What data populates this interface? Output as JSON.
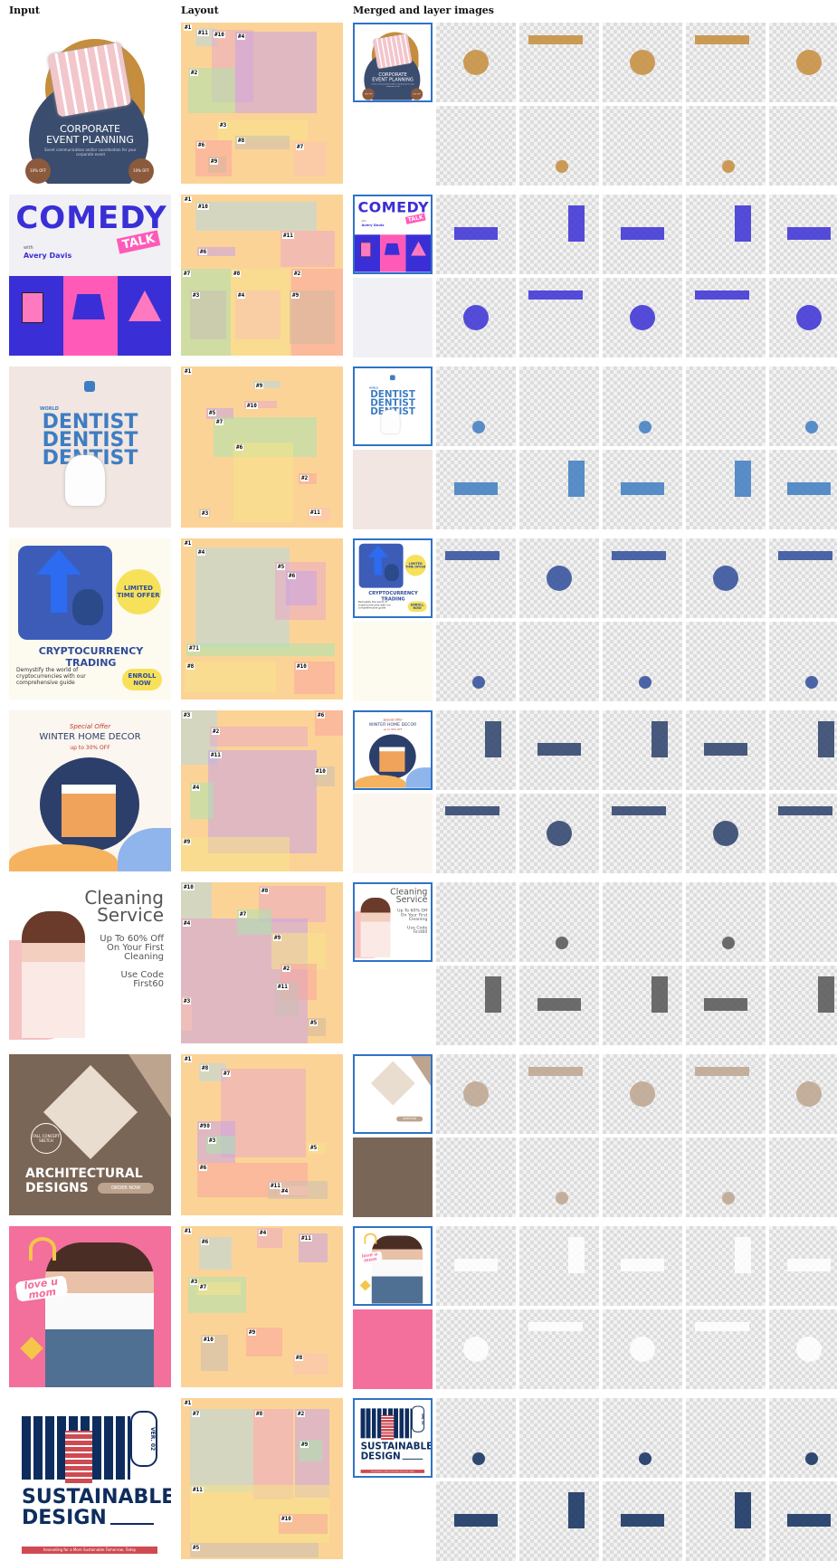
{
  "headers": {
    "input": "Input",
    "layout": "Layout",
    "merged": "Merged and layer images"
  },
  "rows": [
    {
      "id": "corporate",
      "input_title": "CORPORATE\nEVENT PLANNING",
      "input_sub": "Event communication and/or coordination for your corporate event",
      "badge_left": "10% OFF",
      "badge_right": "10% OFF",
      "colors": {
        "bg": "#ffffff",
        "accent": "#c58d3c",
        "dark": "#3b4d6e"
      },
      "tags": [
        "#1",
        "#5",
        "#4",
        "#2",
        "#3",
        "#6",
        "#8",
        "#7",
        "#9",
        "#11",
        "#10"
      ]
    },
    {
      "id": "comedy",
      "input_title": "COMEDY",
      "input_badge": "TALK",
      "input_host_prefix": "with",
      "input_host": "Avery Davis",
      "colors": {
        "bg": "#f1f0f4",
        "accent": "#3a2fd6",
        "pink": "#ff5ab8"
      },
      "tags": [
        "#1",
        "#5",
        "#6",
        "#7",
        "#8",
        "#2",
        "#3",
        "#4",
        "#9",
        "#10",
        "#11"
      ]
    },
    {
      "id": "dentist",
      "input_title": "DENTIST\nDENTIST\nDENTIST",
      "input_small": "WORLD",
      "colors": {
        "bg": "#f1e6e2",
        "accent": "#3e7dc2"
      },
      "tags": [
        "#1",
        "#4",
        "#5",
        "#7",
        "#6",
        "#2",
        "#3",
        "#11",
        "#9",
        "#10"
      ]
    },
    {
      "id": "crypto",
      "input_title": "CRYPTOCURRENCY TRADING",
      "input_badge": "LIMITED TIME OFFER",
      "input_sub": "Demystify the world of cryptocurrencies with our comprehensive guide",
      "input_cta": "ENROLL NOW",
      "colors": {
        "bg": "#fdfaf0",
        "accent": "#2f4c9a",
        "yellow": "#f7e15a"
      },
      "tags": [
        "#1",
        "#2",
        "#3",
        "#11",
        "#9",
        "#10",
        "#4",
        "#5",
        "#6",
        "#7",
        "#8"
      ]
    },
    {
      "id": "winter",
      "input_small": "Special Offer",
      "input_title": "WINTER HOME DECOR",
      "input_sub": "up to 30% OFF",
      "colors": {
        "bg": "#fbf6ef",
        "accent": "#2c3f6b",
        "orange": "#f5b35f"
      },
      "tags": [
        "#7",
        "#8",
        "#5",
        "#4",
        "#9",
        "#6",
        "#10",
        "#3",
        "#2",
        "#11"
      ]
    },
    {
      "id": "cleaning",
      "input_title": "Cleaning\nService",
      "input_sub": "Up To 60% Off\nOn Your First\nCleaning",
      "input_code": "Use Code\nFirst60",
      "colors": {
        "bg": "#ffffff",
        "accent": "#555555",
        "pink": "#f6c1c1"
      },
      "tags": [
        "#6",
        "#8",
        "#4",
        "#7",
        "#9",
        "#2",
        "#11",
        "#3",
        "#5",
        "#10"
      ]
    },
    {
      "id": "architect",
      "input_title": "ARCHITECTURAL\nDESIGNS",
      "input_cta": "ORDER NOW",
      "input_badge": "FALL CONCEPT SKETCH",
      "colors": {
        "bg": "#7a6657",
        "accent": "#bda48f"
      },
      "tags": [
        "#1",
        "#2",
        "#10",
        "#3",
        "#5",
        "#6",
        "#11",
        "#4",
        "#8",
        "#7",
        "#9"
      ]
    },
    {
      "id": "mom",
      "input_title": "love u\nmom",
      "colors": {
        "bg": "#f36f9c",
        "accent": "#ffffff"
      },
      "tags": [
        "#1",
        "#2",
        "#5",
        "#3",
        "#7",
        "#9",
        "#10",
        "#8",
        "#6",
        "#4",
        "#11"
      ]
    },
    {
      "id": "sustainable",
      "input_title": "SUSTAINABLE\nDESIGN",
      "input_sub": "Innovating for a More Sustainable Tomorrow, Today",
      "input_vertical": "VER. 02",
      "colors": {
        "bg": "#ffffff",
        "accent": "#0e2d5e",
        "red": "#cf4a51"
      },
      "tags": [
        "#1",
        "#4",
        "#3",
        "#9",
        "#11",
        "#10",
        "#5",
        "#7",
        "#8",
        "#2"
      ]
    }
  ]
}
